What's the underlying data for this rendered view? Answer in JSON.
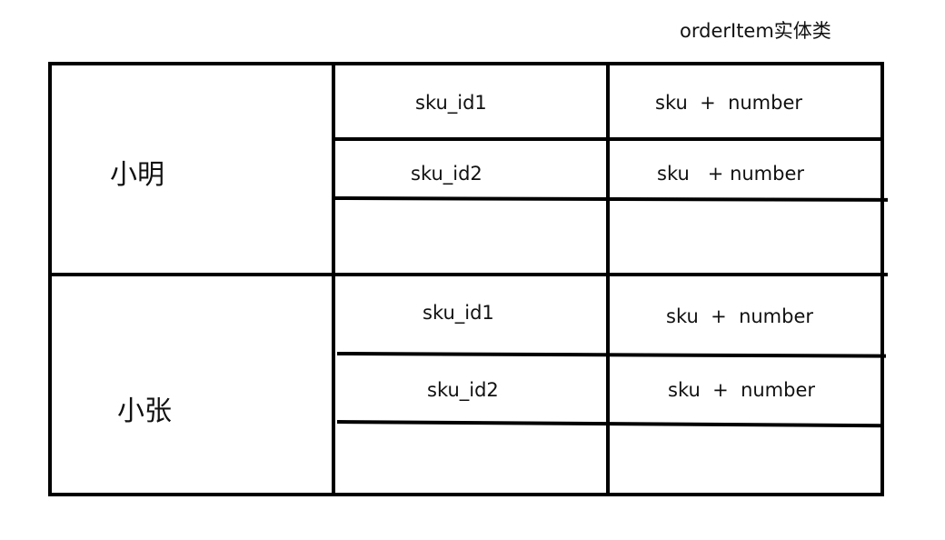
{
  "title": "orderItem实体类",
  "users": [
    {
      "name": "小明",
      "rows": [
        {
          "sku": "sku_id1",
          "item": "sku  +  number"
        },
        {
          "sku": "sku_id2",
          "item": "sku   + number"
        },
        {
          "sku": "",
          "item": ""
        }
      ]
    },
    {
      "name": "小张",
      "rows": [
        {
          "sku": "sku_id1",
          "item": "sku  +  number"
        },
        {
          "sku": "sku_id2",
          "item": "sku  +  number"
        },
        {
          "sku": "",
          "item": ""
        }
      ]
    }
  ]
}
